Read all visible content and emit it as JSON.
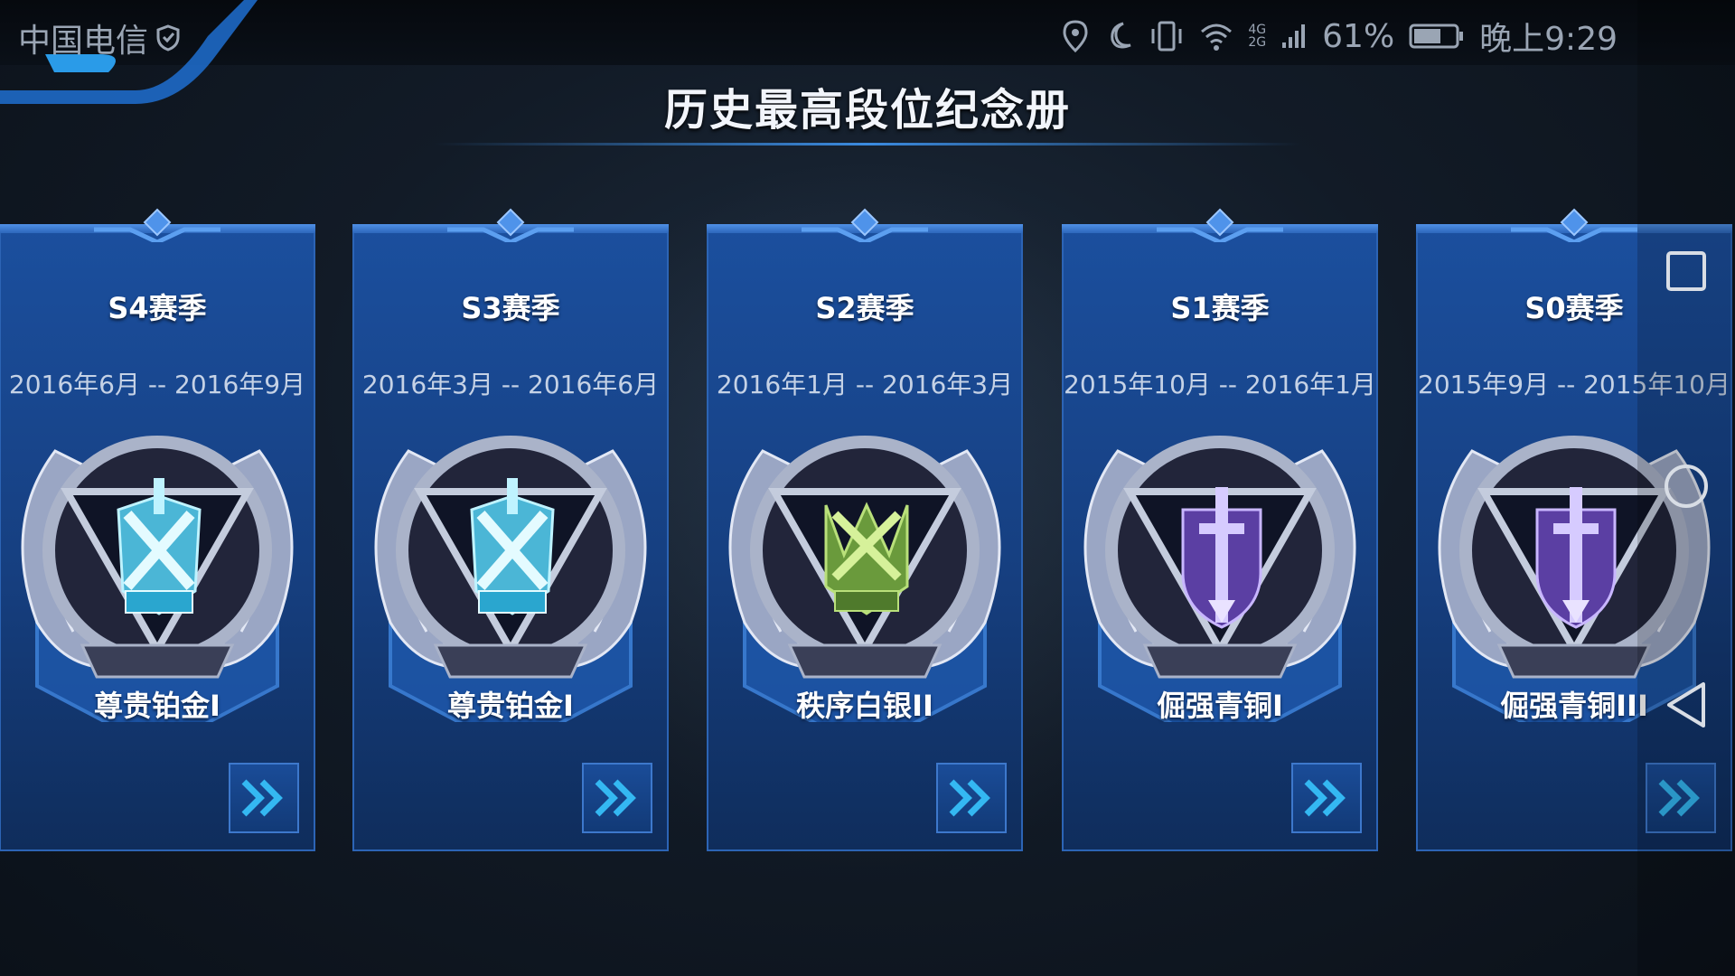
{
  "status_bar": {
    "carrier": "中国电信",
    "network": [
      "4G",
      "2G"
    ],
    "battery": "61%",
    "time": "晚上9:29"
  },
  "page": {
    "title": "历史最高段位纪念册"
  },
  "seasons": [
    {
      "season": "S4赛季",
      "dates": "2016年6月 -- 2016年9月",
      "rank": "尊贵铂金I",
      "tier": "platinum"
    },
    {
      "season": "S3赛季",
      "dates": "2016年3月 -- 2016年6月",
      "rank": "尊贵铂金I",
      "tier": "platinum"
    },
    {
      "season": "S2赛季",
      "dates": "2016年1月 -- 2016年3月",
      "rank": "秩序白银II",
      "tier": "silver"
    },
    {
      "season": "S1赛季",
      "dates": "2015年10月 -- 2016年1月",
      "rank": "倔强青铜I",
      "tier": "bronze"
    },
    {
      "season": "S0赛季",
      "dates": "2015年9月 -- 2015年10月",
      "rank": "倔强青铜III",
      "tier": "bronze"
    }
  ],
  "colors": {
    "platinum": "#5fd3e6",
    "silver": "#7fb04a",
    "bronze": "#7a5ec4",
    "accent": "#3b8be0"
  },
  "icons": {
    "next": "double-chevron-right-icon",
    "nav_recent": "square-icon",
    "nav_home": "circle-icon",
    "nav_back": "triangle-back-icon"
  }
}
